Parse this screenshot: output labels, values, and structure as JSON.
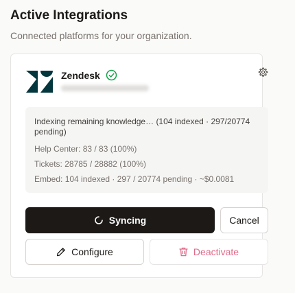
{
  "header": {
    "title": "Active Integrations",
    "subtitle": "Connected platforms for your organization."
  },
  "integration": {
    "name": "Zendesk",
    "logo_icon": "zendesk-logo",
    "status_icon": "check-circle-icon",
    "settings_icon": "gear-icon",
    "status": {
      "main": "Indexing remaining knowledge… (104 indexed · 297/20774 pending)",
      "help_center": "Help Center: 83 / 83 (100%)",
      "tickets": "Tickets: 28785 / 28882 (100%)",
      "embed": "Embed: 104 indexed · 297 / 20774 pending · ~$0.0081"
    }
  },
  "actions": {
    "sync_label": "Syncing",
    "cancel_label": "Cancel",
    "configure_label": "Configure",
    "deactivate_label": "Deactivate"
  },
  "colors": {
    "primary": "#1c1917",
    "success": "#16a34a",
    "danger": "#e06a8a",
    "brand": "#03363d"
  }
}
